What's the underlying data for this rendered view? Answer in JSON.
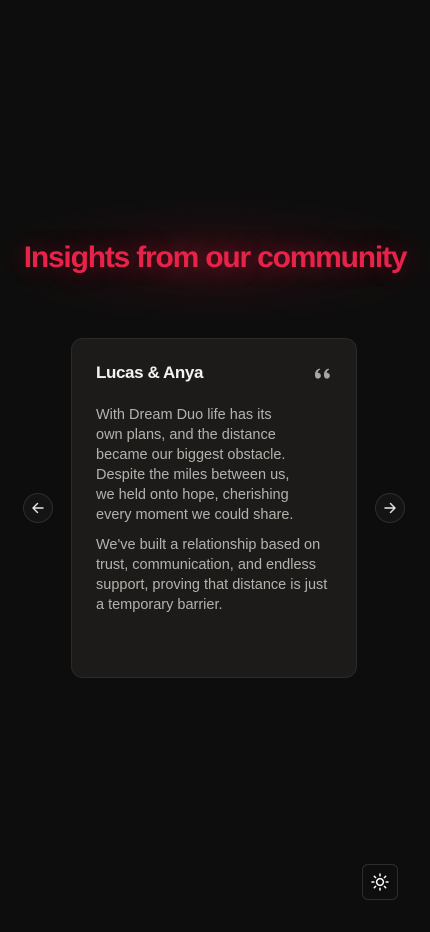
{
  "section": {
    "heading": "Insights from our community"
  },
  "testimonial": {
    "author": "Lucas & Anya",
    "paragraphs": [
      "With Dream Duo life has its own plans, and the distance became our biggest obstacle. Despite the miles between us, we held onto hope, cherishing every moment we could share.",
      "We've built a relationship based on trust, communication, and endless support, proving that distance is just a temporary barrier."
    ],
    "quote_icon": "quote-icon"
  },
  "carousel": {
    "prev_icon": "arrow-left-icon",
    "next_icon": "arrow-right-icon"
  },
  "theme_toggle": {
    "icon": "sun-icon"
  },
  "colors": {
    "accent": "#e8234a",
    "background": "#0e0d0d",
    "card": "#1d1b1a",
    "text_primary": "#f4f2f0",
    "text_secondary": "#b4b0ab"
  }
}
